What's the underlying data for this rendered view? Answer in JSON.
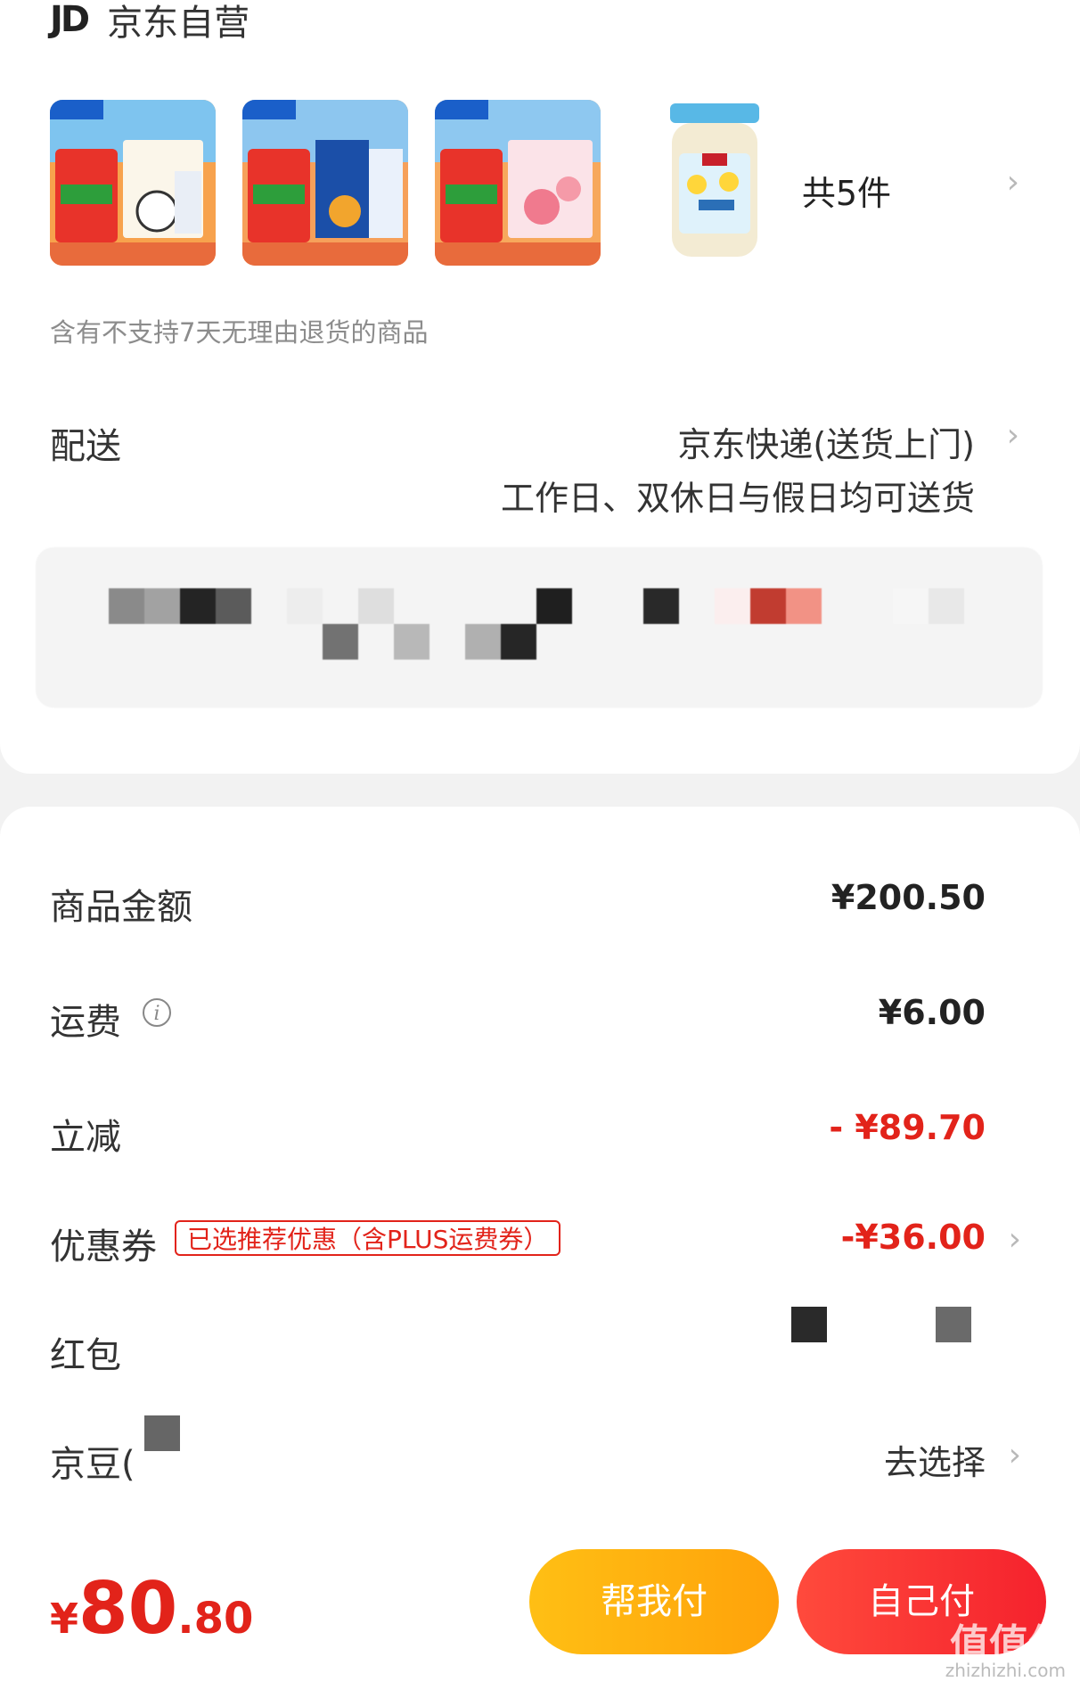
{
  "shop": {
    "logo": "JD",
    "name": "京东自营"
  },
  "products": {
    "count_text": "共5件",
    "thumbnails": [
      "mengniu-milk-pack-1",
      "mengniu-yogurt-pack",
      "mengniu-pink-drink-pack",
      "mccormick-salad-dressing-jar"
    ],
    "return_note": "含有不支持7天无理由退货的商品"
  },
  "delivery": {
    "label": "配送",
    "method": "京东快递(送货上门)",
    "schedule": "工作日、双休日与假日均可送货"
  },
  "amounts": {
    "goods_label": "商品金额",
    "goods_value": "¥200.50",
    "shipping_label": "运费",
    "shipping_value": "¥6.00",
    "discount_label": "立减",
    "discount_value": "- ¥89.70",
    "coupon_label": "优惠券",
    "coupon_tag": "已选推荐优惠（含PLUS运费券）",
    "coupon_value": "-¥36.00",
    "redpacket_label": "红包",
    "jingdou_label": "京豆(",
    "jingdou_action": "去选择"
  },
  "footer": {
    "total_symbol": "¥",
    "total_int": "80",
    "total_dec": ".80",
    "help_pay": "帮我付",
    "self_pay": "自己付",
    "watermark": "值值值",
    "watermark_url": "zhizhizhi.com"
  },
  "colors": {
    "accent_red": "#e2231a",
    "help_btn": "#ffb10f",
    "self_btn": "#f5222d"
  }
}
